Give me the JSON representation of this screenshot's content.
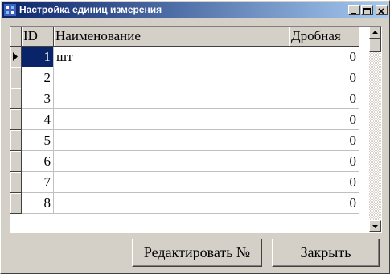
{
  "window": {
    "title": "Настройка единиц измерения"
  },
  "grid": {
    "columns": [
      "ID",
      "Наименование",
      "Дробная"
    ],
    "rows": [
      {
        "id": "1",
        "name": "шт",
        "fractional": "0",
        "selected": true
      },
      {
        "id": "2",
        "name": "",
        "fractional": "0"
      },
      {
        "id": "3",
        "name": "",
        "fractional": "0"
      },
      {
        "id": "4",
        "name": "",
        "fractional": "0"
      },
      {
        "id": "5",
        "name": "",
        "fractional": "0"
      },
      {
        "id": "6",
        "name": "",
        "fractional": "0"
      },
      {
        "id": "7",
        "name": "",
        "fractional": "0"
      },
      {
        "id": "8",
        "name": "",
        "fractional": "0"
      }
    ]
  },
  "buttons": {
    "edit_label": "Редактировать №",
    "close_label": "Закрыть"
  },
  "colors": {
    "title_start": "#0a246a",
    "title_end": "#a6caf0",
    "selection": "#0a246a",
    "face": "#d4d0c8"
  }
}
